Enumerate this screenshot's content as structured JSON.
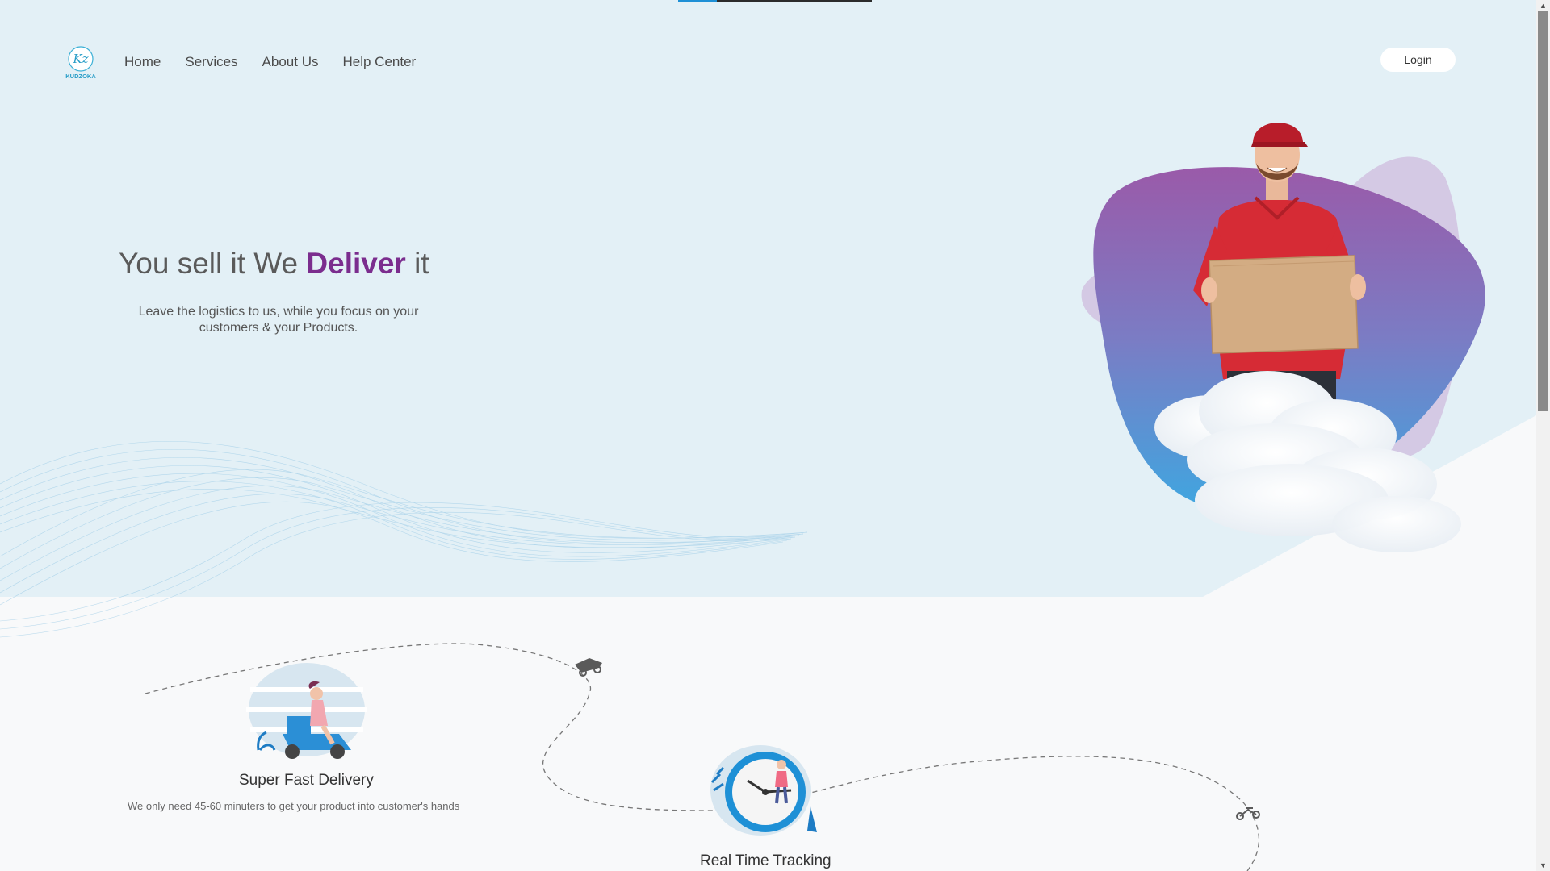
{
  "brand": {
    "logo_letters": "Kz",
    "logo_text": "KUDZOKA"
  },
  "nav": {
    "items": [
      {
        "label": "Home"
      },
      {
        "label": "Services"
      },
      {
        "label": "About Us"
      },
      {
        "label": "Help Center"
      }
    ],
    "login_label": "Login"
  },
  "hero": {
    "title_part1": "You sell it We ",
    "title_accent": "Deliver",
    "title_part2": " it",
    "subtitle": "Leave the logistics to us, while you focus on your customers & your Products."
  },
  "features": [
    {
      "title": "Super Fast Delivery",
      "description": "We only need 45-60 minuters to get your product into customer's hands",
      "icon": "scooter-delivery-icon"
    },
    {
      "title": "Real Time Tracking",
      "icon": "clock-tracking-icon"
    }
  ],
  "colors": {
    "hero_bg": "#e3f0f6",
    "accent": "#7b2d8e",
    "page_bg": "#f8f9fa",
    "blob_top": "#9b59a8",
    "blob_bottom": "#4a9ad6",
    "shirt": "#d62b35"
  },
  "scroll": {
    "position_fraction": 0.0
  }
}
